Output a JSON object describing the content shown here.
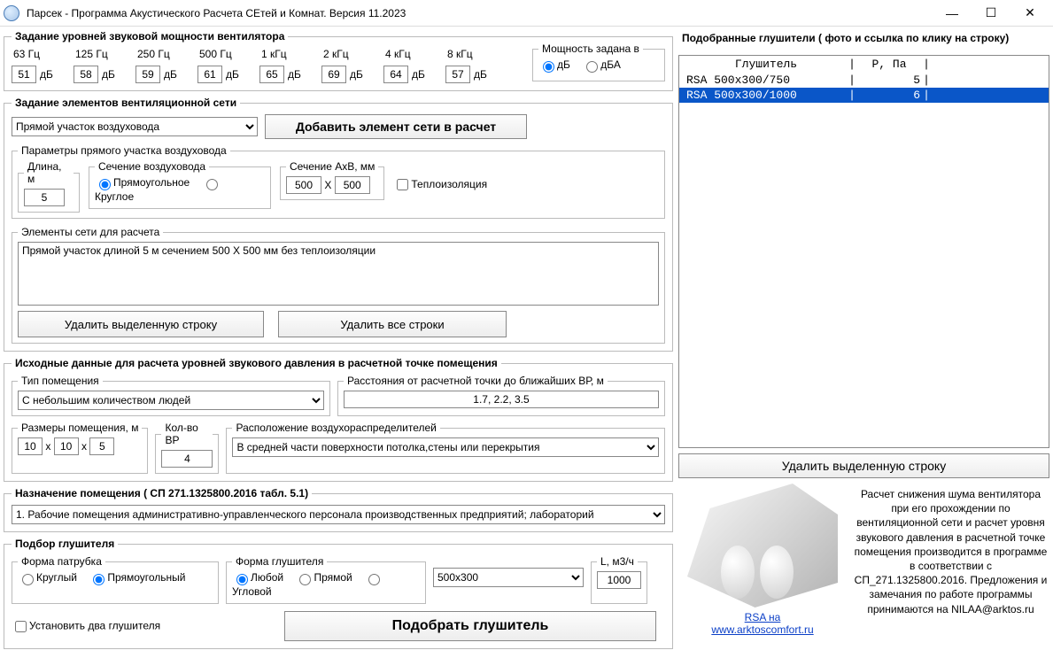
{
  "window": {
    "title": "Парсек - Программа Акустического Расчета СЕтей и Комнат.    Версия 11.2023"
  },
  "fan": {
    "legend": "Задание уровней звуковой мощности вентилятора",
    "freqs": [
      {
        "label": "63 Гц",
        "val": "51"
      },
      {
        "label": "125 Гц",
        "val": "58"
      },
      {
        "label": "250 Гц",
        "val": "59"
      },
      {
        "label": "500 Гц",
        "val": "61"
      },
      {
        "label": "1 кГц",
        "val": "65"
      },
      {
        "label": "2 кГц",
        "val": "69"
      },
      {
        "label": "4 кГц",
        "val": "64"
      },
      {
        "label": "8 кГц",
        "val": "57"
      }
    ],
    "db": "дБ",
    "power_legend": "Мощность задана в",
    "power_db": "дБ",
    "power_dba": "дБА"
  },
  "net": {
    "legend": "Задание элементов вентиляционной сети",
    "element_sel": "Прямой участок воздуховода",
    "add_btn": "Добавить элемент сети в расчет",
    "params_legend": "Параметры прямого участка воздуховода",
    "len_legend": "Длина, м",
    "len_val": "5",
    "sect_legend": "Сечение воздуховода",
    "sect_rect": "Прямоугольное",
    "sect_round": "Круглое",
    "axb_legend": "Сечение АхВ, мм",
    "a_val": "500",
    "b_val": "500",
    "axb_x": "X",
    "iso": "Теплоизоляция",
    "list_legend": "Элементы сети для расчета",
    "list_item": "Прямой участок длиной 5 м сечением 500 Х 500 мм без теплоизоляции",
    "del_row": "Удалить выделенную строку",
    "del_all": "Удалить все строки"
  },
  "room": {
    "legend": "Исходные данные для расчета уровней звукового давления в расчетной точке помещения",
    "type_legend": "Тип помещения",
    "type_sel": "С небольшим количеством людей",
    "dist_legend": "Расстояния от расчетной точки до ближайших ВР, м",
    "dist_val": "1.7, 2.2, 3.5",
    "dims_legend": "Размеры помещения, м",
    "dim_a": "10",
    "dim_b": "10",
    "dim_c": "5",
    "dim_x": "x",
    "qty_legend": "Кол-во ВР",
    "qty_val": "4",
    "loc_legend": "Расположение воздухораспределителей",
    "loc_sel": "В средней части поверхности потолка,стены или перекрытия"
  },
  "purpose": {
    "legend": "Назначение помещения  ( СП 271.1325800.2016 табл. 5.1)",
    "sel": "1. Рабочие помещения административно-управленческого персонала производственных предприятий; лабораторий"
  },
  "sil": {
    "legend": "Подбор глушителя",
    "nozzle_legend": "Форма патрубка",
    "nozzle_round": "Круглый",
    "nozzle_rect": "Прямоугольный",
    "shape_legend": "Форма глушителя",
    "shape_any": "Любой",
    "shape_straight": "Прямой",
    "shape_angle": "Угловой",
    "size_sel": "500x300",
    "flow_legend": "L, м3/ч",
    "flow_val": "1000",
    "two_chk": "Установить два глушителя",
    "pick_btn": "Подобрать глушитель"
  },
  "picked": {
    "legend": "Подобранные глушители  ( фото и ссылка по клику на строку)",
    "hdr_name": "Глушитель",
    "hdr_p": "Р, Па",
    "rows": [
      {
        "name": "RSA 500x300/750",
        "p": "5"
      },
      {
        "name": "RSA 500x300/1000",
        "p": "6"
      }
    ],
    "del": "Удалить выделенную строку",
    "link1": "RSA на",
    "link2": "www.arktoscomfort.ru",
    "info": "Расчет снижения шума вентилятора при  его прохождении по вентиляционной сети и расчет уровня звукового давления в расчетной точке помещения производится в программе в соответствии с СП_271.1325800.2016.  Предложения и замечания по работе программы принимаются на NILAA@arktos.ru"
  }
}
